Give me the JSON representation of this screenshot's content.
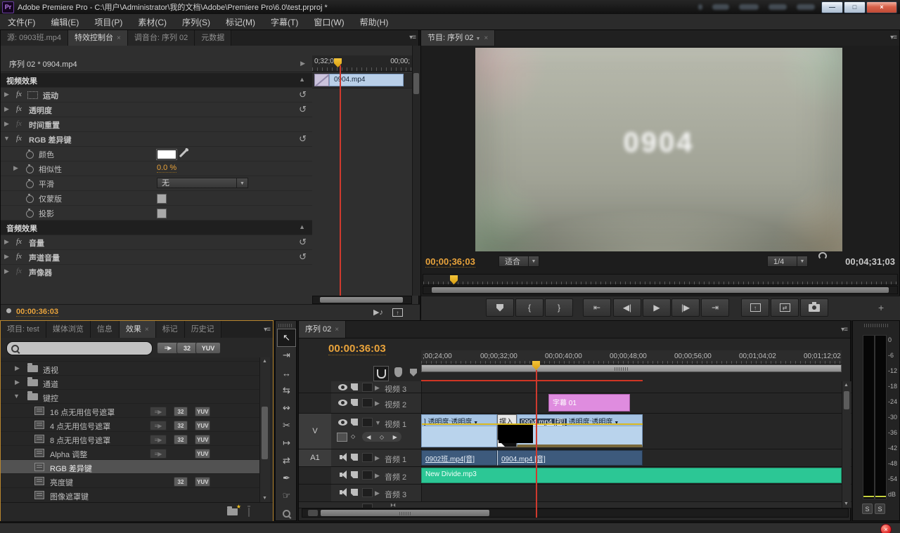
{
  "titlebar": {
    "app_logo": "Pr",
    "title": "Adobe Premiere Pro - C:\\用户\\Administrator\\我的文档\\Adobe\\Premiere Pro\\6.0\\test.prproj *",
    "minimize": "—",
    "restore": "□",
    "close": "×"
  },
  "menu": {
    "items": [
      "文件(F)",
      "编辑(E)",
      "项目(P)",
      "素材(C)",
      "序列(S)",
      "标记(M)",
      "字幕(T)",
      "窗口(W)",
      "帮助(H)"
    ]
  },
  "effect_controls": {
    "tabs": {
      "source": "源: 0903班.mp4",
      "effects": "特效控制台",
      "mixer": "调音台: 序列 02",
      "metadata": "元数据"
    },
    "header": "序列 02 * 0904.mp4",
    "ruler_start": "0;32;00",
    "ruler_end": "00;00;",
    "clip": "0904.mp4",
    "video_header": "视频效果",
    "motion": "运动",
    "opacity": "透明度",
    "time_remap": "时间重置",
    "rgb_key": "RGB 差异键",
    "color_label": "颜色",
    "similarity_label": "相似性",
    "similarity_value": "0.0 %",
    "smooth_label": "平滑",
    "smooth_value": "无",
    "mask_only_label": "仅蒙版",
    "shadow_label": "投影",
    "audio_header": "音频效果",
    "volume": "音量",
    "channel_volume": "声道音量",
    "panner": "声像器",
    "timecode": "00:00:36:03"
  },
  "program": {
    "tab": "节目: 序列 02",
    "overlay": "0904",
    "timecode": "00;00;36;03",
    "fit": "适合",
    "resolution": "1/4",
    "duration": "00;04;31;03",
    "transport": {
      "mark_in": "{",
      "mark_out": "}",
      "goto_in": "⇤",
      "step_back": "◀|",
      "play": "▶",
      "step_fwd": "|▶",
      "goto_out": "⇥",
      "lift": "↑",
      "extract": "⇄",
      "add": "+"
    }
  },
  "effects_panel": {
    "tabs": {
      "project": "项目: test",
      "media": "媒体浏览",
      "info": "信息",
      "effects": "效果",
      "markers": "标记",
      "history": "历史记"
    },
    "badge_32": "32",
    "badge_yuv": "YUV",
    "folders": [
      "透视",
      "通道",
      "键控"
    ],
    "items": [
      {
        "name": "16 点无用信号遮罩",
        "accel": true,
        "b32": true,
        "yuv": true
      },
      {
        "name": "4 点无用信号遮罩",
        "accel": true,
        "b32": true,
        "yuv": true
      },
      {
        "name": "8 点无用信号遮罩",
        "accel": true,
        "b32": true,
        "yuv": true
      },
      {
        "name": "Alpha 调整",
        "accel": true,
        "b32": false,
        "yuv": true
      },
      {
        "name": "RGB 差异键",
        "accel": false,
        "b32": false,
        "yuv": false,
        "selected": true
      },
      {
        "name": "亮度键",
        "accel": false,
        "b32": true,
        "yuv": true
      },
      {
        "name": "图像遮罩键",
        "accel": false,
        "b32": false,
        "yuv": false
      }
    ]
  },
  "tools": [
    {
      "name": "selection-tool",
      "glyph": "↖"
    },
    {
      "name": "track-select-tool",
      "glyph": "⇥"
    },
    {
      "name": "ripple-edit-tool",
      "glyph": "↔"
    },
    {
      "name": "rolling-edit-tool",
      "glyph": "⇆"
    },
    {
      "name": "rate-stretch-tool",
      "glyph": "↭"
    },
    {
      "name": "razor-tool",
      "glyph": "✂"
    },
    {
      "name": "slip-tool",
      "glyph": "↦"
    },
    {
      "name": "slide-tool",
      "glyph": "⇄"
    },
    {
      "name": "pen-tool",
      "glyph": "✒"
    },
    {
      "name": "hand-tool",
      "glyph": "☞"
    },
    {
      "name": "zoom-tool",
      "glyph": ""
    }
  ],
  "timeline": {
    "tab": "序列 02",
    "timecode": "00:00:36:03",
    "ruler": [
      ";00;24;00",
      "00;00;32;00",
      "00;00;40;00",
      "00;00;48;00",
      "00;00;56;00",
      "00;01;04;02",
      "00;01;12;02"
    ],
    "tracks": {
      "v3": "视频 3",
      "v2": "视频 2",
      "v1": "视频 1",
      "a1": "音频 1",
      "a2": "音频 2",
      "a3": "音频 3"
    },
    "badges": {
      "v": "V",
      "a1": "A1"
    },
    "clips": {
      "title": "字幕 01",
      "v1_left_fx": "透明度:透明度",
      "transition": "摆入",
      "v1_name": "0904.mp4 [视]",
      "v1_fx": "透明度:透明度",
      "a1_left": "0902班.mp4[音]",
      "a1_right": "0904.mp4 [音]",
      "a2": "New Divide.mp3"
    }
  },
  "meter": {
    "ticks": [
      "0",
      "-6",
      "-12",
      "-18",
      "-24",
      "-30",
      "-36",
      "-42",
      "-48",
      "-54",
      "dB"
    ],
    "solo": "S"
  }
}
